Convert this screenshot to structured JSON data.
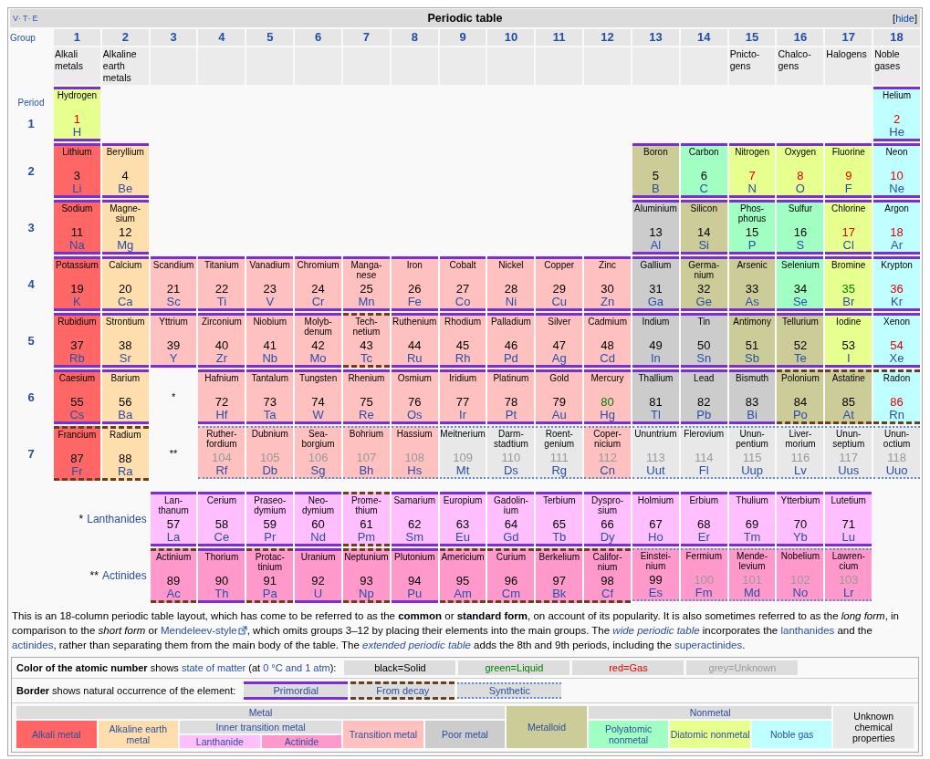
{
  "navbox": {
    "links": [
      "V",
      "T",
      "E"
    ],
    "separator": "·",
    "title": "Periodic table",
    "toggle": {
      "open": "[",
      "label": "hide",
      "close": "]"
    }
  },
  "group_heading": "Group",
  "groups": [
    {
      "number": "1",
      "name": "Alkali metals"
    },
    {
      "number": "2",
      "name": "Alkaline earth metals"
    },
    {
      "number": "3"
    },
    {
      "number": "4"
    },
    {
      "number": "5"
    },
    {
      "number": "6"
    },
    {
      "number": "7"
    },
    {
      "number": "8"
    },
    {
      "number": "9"
    },
    {
      "number": "10"
    },
    {
      "number": "11"
    },
    {
      "number": "12"
    },
    {
      "number": "13"
    },
    {
      "number": "14"
    },
    {
      "number": "15",
      "name": "Pnicto-gens"
    },
    {
      "number": "16",
      "name": "Chalco-gens"
    },
    {
      "number": "17",
      "name": "Halogens"
    },
    {
      "number": "18",
      "name": "Noble gases"
    }
  ],
  "period_heading": "Period",
  "periods": [
    {
      "label": "1",
      "cells": [
        {
          "kind": "primordial",
          "name": "Hydrogen",
          "number": {
            "text": "1",
            "color": "#e00000"
          },
          "symbol": "H",
          "color": "#e7ff8f"
        },
        {
          "kind": "empty"
        },
        {
          "kind": "empty"
        },
        {
          "kind": "empty"
        },
        {
          "kind": "empty"
        },
        {
          "kind": "empty"
        },
        {
          "kind": "empty"
        },
        {
          "kind": "empty"
        },
        {
          "kind": "empty"
        },
        {
          "kind": "empty"
        },
        {
          "kind": "empty"
        },
        {
          "kind": "empty"
        },
        {
          "kind": "empty"
        },
        {
          "kind": "empty"
        },
        {
          "kind": "empty"
        },
        {
          "kind": "empty"
        },
        {
          "kind": "empty"
        },
        {
          "kind": "primordial",
          "name": "Helium",
          "number": {
            "text": "2",
            "color": "#e00000"
          },
          "symbol": "He",
          "color": "#c0ffff"
        }
      ]
    },
    {
      "label": "2",
      "cells": [
        {
          "kind": "primordial",
          "name": "Lithium",
          "number": {
            "text": "3",
            "color": "#000000"
          },
          "symbol": "Li",
          "color": "#ff6666"
        },
        {
          "kind": "primordial",
          "name": "Beryllium",
          "number": {
            "text": "4",
            "color": "#000000"
          },
          "symbol": "Be",
          "color": "#ffdead"
        },
        {
          "kind": "empty"
        },
        {
          "kind": "empty"
        },
        {
          "kind": "empty"
        },
        {
          "kind": "empty"
        },
        {
          "kind": "empty"
        },
        {
          "kind": "empty"
        },
        {
          "kind": "empty"
        },
        {
          "kind": "empty"
        },
        {
          "kind": "empty"
        },
        {
          "kind": "empty"
        },
        {
          "kind": "primordial",
          "name": "Boron",
          "number": {
            "text": "5",
            "color": "#000000"
          },
          "symbol": "B",
          "color": "#cccc99"
        },
        {
          "kind": "primordial",
          "name": "Carbon",
          "number": {
            "text": "6",
            "color": "#000000"
          },
          "symbol": "C",
          "color": "#a1ffc3"
        },
        {
          "kind": "primordial",
          "name": "Nitrogen",
          "number": {
            "text": "7",
            "color": "#e00000"
          },
          "symbol": "N",
          "color": "#e7ff8f"
        },
        {
          "kind": "primordial",
          "name": "Oxygen",
          "number": {
            "text": "8",
            "color": "#e00000"
          },
          "symbol": "O",
          "color": "#e7ff8f"
        },
        {
          "kind": "primordial",
          "name": "Fluorine",
          "number": {
            "text": "9",
            "color": "#e00000"
          },
          "symbol": "F",
          "color": "#e7ff8f"
        },
        {
          "kind": "primordial",
          "name": "Neon",
          "number": {
            "text": "10",
            "color": "#e00000"
          },
          "symbol": "Ne",
          "color": "#c0ffff"
        }
      ]
    },
    {
      "label": "3",
      "cells": [
        {
          "kind": "primordial",
          "name": "Sodium",
          "number": {
            "text": "11",
            "color": "#000000"
          },
          "symbol": "Na",
          "color": "#ff6666"
        },
        {
          "kind": "primordial",
          "name": "Magne-sium",
          "number": {
            "text": "12",
            "color": "#000000"
          },
          "symbol": "Mg",
          "color": "#ffdead"
        },
        {
          "kind": "empty"
        },
        {
          "kind": "empty"
        },
        {
          "kind": "empty"
        },
        {
          "kind": "empty"
        },
        {
          "kind": "empty"
        },
        {
          "kind": "empty"
        },
        {
          "kind": "empty"
        },
        {
          "kind": "empty"
        },
        {
          "kind": "empty"
        },
        {
          "kind": "empty"
        },
        {
          "kind": "primordial",
          "name": "Aluminium",
          "number": {
            "text": "13",
            "color": "#000000"
          },
          "symbol": "Al",
          "color": "#cccccc"
        },
        {
          "kind": "primordial",
          "name": "Silicon",
          "number": {
            "text": "14",
            "color": "#000000"
          },
          "symbol": "Si",
          "color": "#cccc99"
        },
        {
          "kind": "primordial",
          "name": "Phos-phorus",
          "number": {
            "text": "15",
            "color": "#000000"
          },
          "symbol": "P",
          "color": "#a1ffc3"
        },
        {
          "kind": "primordial",
          "name": "Sulfur",
          "number": {
            "text": "16",
            "color": "#000000"
          },
          "symbol": "S",
          "color": "#a1ffc3"
        },
        {
          "kind": "primordial",
          "name": "Chlorine",
          "number": {
            "text": "17",
            "color": "#e00000"
          },
          "symbol": "Cl",
          "color": "#e7ff8f"
        },
        {
          "kind": "primordial",
          "name": "Argon",
          "number": {
            "text": "18",
            "color": "#e00000"
          },
          "symbol": "Ar",
          "color": "#c0ffff"
        }
      ]
    },
    {
      "label": "4",
      "cells": [
        {
          "kind": "primordial",
          "name": "Potassium",
          "number": {
            "text": "19",
            "color": "#000000"
          },
          "symbol": "K",
          "color": "#ff6666"
        },
        {
          "kind": "primordial",
          "name": "Calcium",
          "number": {
            "text": "20",
            "color": "#000000"
          },
          "symbol": "Ca",
          "color": "#ffdead"
        },
        {
          "kind": "primordial",
          "name": "Scandium",
          "number": {
            "text": "21",
            "color": "#000000"
          },
          "symbol": "Sc",
          "color": "#ffc0c0"
        },
        {
          "kind": "primordial",
          "name": "Titanium",
          "number": {
            "text": "22",
            "color": "#000000"
          },
          "symbol": "Ti",
          "color": "#ffc0c0"
        },
        {
          "kind": "primordial",
          "name": "Vanadium",
          "number": {
            "text": "23",
            "color": "#000000"
          },
          "symbol": "V",
          "color": "#ffc0c0"
        },
        {
          "kind": "primordial",
          "name": "Chromium",
          "number": {
            "text": "24",
            "color": "#000000"
          },
          "symbol": "Cr",
          "color": "#ffc0c0"
        },
        {
          "kind": "primordial",
          "name": "Manga-nese",
          "number": {
            "text": "25",
            "color": "#000000"
          },
          "symbol": "Mn",
          "color": "#ffc0c0"
        },
        {
          "kind": "primordial",
          "name": "Iron",
          "number": {
            "text": "26",
            "color": "#000000"
          },
          "symbol": "Fe",
          "color": "#ffc0c0"
        },
        {
          "kind": "primordial",
          "name": "Cobalt",
          "number": {
            "text": "27",
            "color": "#000000"
          },
          "symbol": "Co",
          "color": "#ffc0c0"
        },
        {
          "kind": "primordial",
          "name": "Nickel",
          "number": {
            "text": "28",
            "color": "#000000"
          },
          "symbol": "Ni",
          "color": "#ffc0c0"
        },
        {
          "kind": "primordial",
          "name": "Copper",
          "number": {
            "text": "29",
            "color": "#000000"
          },
          "symbol": "Cu",
          "color": "#ffc0c0"
        },
        {
          "kind": "primordial",
          "name": "Zinc",
          "number": {
            "text": "30",
            "color": "#000000"
          },
          "symbol": "Zn",
          "color": "#ffc0c0"
        },
        {
          "kind": "primordial",
          "name": "Gallium",
          "number": {
            "text": "31",
            "color": "#000000"
          },
          "symbol": "Ga",
          "color": "#cccccc"
        },
        {
          "kind": "primordial",
          "name": "Germa-nium",
          "number": {
            "text": "32",
            "color": "#000000"
          },
          "symbol": "Ge",
          "color": "#cccc99"
        },
        {
          "kind": "primordial",
          "name": "Arsenic",
          "number": {
            "text": "33",
            "color": "#000000"
          },
          "symbol": "As",
          "color": "#cccc99"
        },
        {
          "kind": "primordial",
          "name": "Selenium",
          "number": {
            "text": "34",
            "color": "#000000"
          },
          "symbol": "Se",
          "color": "#a1ffc3"
        },
        {
          "kind": "primordial",
          "name": "Bromine",
          "number": {
            "text": "35",
            "color": "#008000"
          },
          "symbol": "Br",
          "color": "#e7ff8f"
        },
        {
          "kind": "primordial",
          "name": "Krypton",
          "number": {
            "text": "36",
            "color": "#e00000"
          },
          "symbol": "Kr",
          "color": "#c0ffff"
        }
      ]
    },
    {
      "label": "5",
      "cells": [
        {
          "kind": "primordial",
          "name": "Rubidium",
          "number": {
            "text": "37",
            "color": "#000000"
          },
          "symbol": "Rb",
          "color": "#ff6666"
        },
        {
          "kind": "primordial",
          "name": "Strontium",
          "number": {
            "text": "38",
            "color": "#000000"
          },
          "symbol": "Sr",
          "color": "#ffdead"
        },
        {
          "kind": "primordial",
          "name": "Yttrium",
          "number": {
            "text": "39",
            "color": "#000000"
          },
          "symbol": "Y",
          "color": "#ffc0c0"
        },
        {
          "kind": "primordial",
          "name": "Zirconium",
          "number": {
            "text": "40",
            "color": "#000000"
          },
          "symbol": "Zr",
          "color": "#ffc0c0"
        },
        {
          "kind": "primordial",
          "name": "Niobium",
          "number": {
            "text": "41",
            "color": "#000000"
          },
          "symbol": "Nb",
          "color": "#ffc0c0"
        },
        {
          "kind": "primordial",
          "name": "Molyb-denum",
          "number": {
            "text": "42",
            "color": "#000000"
          },
          "symbol": "Mo",
          "color": "#ffc0c0"
        },
        {
          "kind": "decay",
          "name": "Tech-netium",
          "number": {
            "text": "43",
            "color": "#000000"
          },
          "symbol": "Tc",
          "color": "#ffc0c0"
        },
        {
          "kind": "primordial",
          "name": "Ruthenium",
          "number": {
            "text": "44",
            "color": "#000000"
          },
          "symbol": "Ru",
          "color": "#ffc0c0"
        },
        {
          "kind": "primordial",
          "name": "Rhodium",
          "number": {
            "text": "45",
            "color": "#000000"
          },
          "symbol": "Rh",
          "color": "#ffc0c0"
        },
        {
          "kind": "primordial",
          "name": "Palladium",
          "number": {
            "text": "46",
            "color": "#000000"
          },
          "symbol": "Pd",
          "color": "#ffc0c0"
        },
        {
          "kind": "primordial",
          "name": "Silver",
          "number": {
            "text": "47",
            "color": "#000000"
          },
          "symbol": "Ag",
          "color": "#ffc0c0"
        },
        {
          "kind": "primordial",
          "name": "Cadmium",
          "number": {
            "text": "48",
            "color": "#000000"
          },
          "symbol": "Cd",
          "color": "#ffc0c0"
        },
        {
          "kind": "primordial",
          "name": "Indium",
          "number": {
            "text": "49",
            "color": "#000000"
          },
          "symbol": "In",
          "color": "#cccccc"
        },
        {
          "kind": "primordial",
          "name": "Tin",
          "number": {
            "text": "50",
            "color": "#000000"
          },
          "symbol": "Sn",
          "color": "#cccccc"
        },
        {
          "kind": "primordial",
          "name": "Antimony",
          "number": {
            "text": "51",
            "color": "#000000"
          },
          "symbol": "Sb",
          "color": "#cccc99"
        },
        {
          "kind": "primordial",
          "name": "Tellurium",
          "number": {
            "text": "52",
            "color": "#000000"
          },
          "symbol": "Te",
          "color": "#cccc99"
        },
        {
          "kind": "primordial",
          "name": "Iodine",
          "number": {
            "text": "53",
            "color": "#000000"
          },
          "symbol": "I",
          "color": "#e7ff8f"
        },
        {
          "kind": "primordial",
          "name": "Xenon",
          "number": {
            "text": "54",
            "color": "#e00000"
          },
          "symbol": "Xe",
          "color": "#c0ffff"
        }
      ]
    },
    {
      "label": "6",
      "cells": [
        {
          "kind": "primordial",
          "name": "Caesium",
          "number": {
            "text": "55",
            "color": "#000000"
          },
          "symbol": "Cs",
          "color": "#ff6666"
        },
        {
          "kind": "primordial",
          "name": "Barium",
          "number": {
            "text": "56",
            "color": "#000000"
          },
          "symbol": "Ba",
          "color": "#ffdead"
        },
        {
          "kind": "marker",
          "text": "*"
        },
        {
          "kind": "primordial",
          "name": "Hafnium",
          "number": {
            "text": "72",
            "color": "#000000"
          },
          "symbol": "Hf",
          "color": "#ffc0c0"
        },
        {
          "kind": "primordial",
          "name": "Tantalum",
          "number": {
            "text": "73",
            "color": "#000000"
          },
          "symbol": "Ta",
          "color": "#ffc0c0"
        },
        {
          "kind": "primordial",
          "name": "Tungsten",
          "number": {
            "text": "74",
            "color": "#000000"
          },
          "symbol": "W",
          "color": "#ffc0c0"
        },
        {
          "kind": "primordial",
          "name": "Rhenium",
          "number": {
            "text": "75",
            "color": "#000000"
          },
          "symbol": "Re",
          "color": "#ffc0c0"
        },
        {
          "kind": "primordial",
          "name": "Osmium",
          "number": {
            "text": "76",
            "color": "#000000"
          },
          "symbol": "Os",
          "color": "#ffc0c0"
        },
        {
          "kind": "primordial",
          "name": "Iridium",
          "number": {
            "text": "77",
            "color": "#000000"
          },
          "symbol": "Ir",
          "color": "#ffc0c0"
        },
        {
          "kind": "primordial",
          "name": "Platinum",
          "number": {
            "text": "78",
            "color": "#000000"
          },
          "symbol": "Pt",
          "color": "#ffc0c0"
        },
        {
          "kind": "primordial",
          "name": "Gold",
          "number": {
            "text": "79",
            "color": "#000000"
          },
          "symbol": "Au",
          "color": "#ffc0c0"
        },
        {
          "kind": "primordial",
          "name": "Mercury",
          "number": {
            "text": "80",
            "color": "#008000"
          },
          "symbol": "Hg",
          "color": "#ffc0c0"
        },
        {
          "kind": "primordial",
          "name": "Thallium",
          "number": {
            "text": "81",
            "color": "#000000"
          },
          "symbol": "Tl",
          "color": "#cccccc"
        },
        {
          "kind": "primordial",
          "name": "Lead",
          "number": {
            "text": "82",
            "color": "#000000"
          },
          "symbol": "Pb",
          "color": "#cccccc"
        },
        {
          "kind": "primordial",
          "name": "Bismuth",
          "number": {
            "text": "83",
            "color": "#000000"
          },
          "symbol": "Bi",
          "color": "#cccccc"
        },
        {
          "kind": "decay",
          "name": "Polonium",
          "number": {
            "text": "84",
            "color": "#000000"
          },
          "symbol": "Po",
          "color": "#cccc99"
        },
        {
          "kind": "decay",
          "name": "Astatine",
          "number": {
            "text": "85",
            "color": "#000000"
          },
          "symbol": "At",
          "color": "#cccc99"
        },
        {
          "kind": "decay",
          "name": "Radon",
          "number": {
            "text": "86",
            "color": "#e00000"
          },
          "symbol": "Rn",
          "color": "#c0ffff"
        }
      ]
    },
    {
      "label": "7",
      "cells": [
        {
          "kind": "decay",
          "name": "Francium",
          "number": {
            "text": "87",
            "color": "#000000"
          },
          "symbol": "Fr",
          "color": "#ff6666"
        },
        {
          "kind": "decay",
          "name": "Radium",
          "number": {
            "text": "88",
            "color": "#000000"
          },
          "symbol": "Ra",
          "color": "#ffdead"
        },
        {
          "kind": "marker",
          "text": "**"
        },
        {
          "kind": "synthetic",
          "name": "Ruther-fordium",
          "number": {
            "text": "104",
            "color": "#999999"
          },
          "symbol": "Rf",
          "color": "#ffc0c0"
        },
        {
          "kind": "synthetic",
          "name": "Dubnium",
          "number": {
            "text": "105",
            "color": "#999999"
          },
          "symbol": "Db",
          "color": "#ffc0c0"
        },
        {
          "kind": "synthetic",
          "name": "Sea-borgium",
          "number": {
            "text": "106",
            "color": "#999999"
          },
          "symbol": "Sg",
          "color": "#ffc0c0"
        },
        {
          "kind": "synthetic",
          "name": "Bohrium",
          "number": {
            "text": "107",
            "color": "#999999"
          },
          "symbol": "Bh",
          "color": "#ffc0c0"
        },
        {
          "kind": "synthetic",
          "name": "Hassium",
          "number": {
            "text": "108",
            "color": "#999999"
          },
          "symbol": "Hs",
          "color": "#ffc0c0"
        },
        {
          "kind": "synthetic",
          "name": "Meitnerium",
          "number": {
            "text": "109",
            "color": "#999999"
          },
          "symbol": "Mt",
          "color": "#e8e8e8"
        },
        {
          "kind": "synthetic",
          "name": "Darm-stadtium",
          "number": {
            "text": "110",
            "color": "#999999"
          },
          "symbol": "Ds",
          "color": "#e8e8e8"
        },
        {
          "kind": "synthetic",
          "name": "Roent-genium",
          "number": {
            "text": "111",
            "color": "#999999"
          },
          "symbol": "Rg",
          "color": "#e8e8e8"
        },
        {
          "kind": "synthetic",
          "name": "Coper-nicium",
          "number": {
            "text": "112",
            "color": "#999999"
          },
          "symbol": "Cn",
          "color": "#ffc0c0"
        },
        {
          "kind": "synthetic",
          "name": "Ununtrium",
          "number": {
            "text": "113",
            "color": "#999999"
          },
          "symbol": "Uut",
          "color": "#e8e8e8"
        },
        {
          "kind": "synthetic",
          "name": "Flerovium",
          "number": {
            "text": "114",
            "color": "#999999"
          },
          "symbol": "Fl",
          "color": "#e8e8e8"
        },
        {
          "kind": "synthetic",
          "name": "Unun-pentium",
          "number": {
            "text": "115",
            "color": "#999999"
          },
          "symbol": "Uup",
          "color": "#e8e8e8"
        },
        {
          "kind": "synthetic",
          "name": "Liver-morium",
          "number": {
            "text": "116",
            "color": "#999999"
          },
          "symbol": "Lv",
          "color": "#e8e8e8"
        },
        {
          "kind": "synthetic",
          "name": "Unun-septium",
          "number": {
            "text": "117",
            "color": "#999999"
          },
          "symbol": "Uus",
          "color": "#e8e8e8"
        },
        {
          "kind": "synthetic",
          "name": "Unun-octium",
          "number": {
            "text": "118",
            "color": "#999999"
          },
          "symbol": "Uuo",
          "color": "#e8e8e8"
        }
      ]
    }
  ],
  "series": [
    {
      "mark": "*",
      "label": "Lanthanides",
      "cells": [
        {
          "kind": "primordial",
          "name": "Lan-thanum",
          "number": {
            "text": "57",
            "color": "#000000"
          },
          "symbol": "La",
          "color": "#ffbfff"
        },
        {
          "kind": "primordial",
          "name": "Cerium",
          "number": {
            "text": "58",
            "color": "#000000"
          },
          "symbol": "Ce",
          "color": "#ffbfff"
        },
        {
          "kind": "primordial",
          "name": "Praseo-dymium",
          "number": {
            "text": "59",
            "color": "#000000"
          },
          "symbol": "Pr",
          "color": "#ffbfff"
        },
        {
          "kind": "primordial",
          "name": "Neo-dymium",
          "number": {
            "text": "60",
            "color": "#000000"
          },
          "symbol": "Nd",
          "color": "#ffbfff"
        },
        {
          "kind": "decay",
          "name": "Prome-thium",
          "number": {
            "text": "61",
            "color": "#000000"
          },
          "symbol": "Pm",
          "color": "#ffbfff"
        },
        {
          "kind": "primordial",
          "name": "Samarium",
          "number": {
            "text": "62",
            "color": "#000000"
          },
          "symbol": "Sm",
          "color": "#ffbfff"
        },
        {
          "kind": "primordial",
          "name": "Europium",
          "number": {
            "text": "63",
            "color": "#000000"
          },
          "symbol": "Eu",
          "color": "#ffbfff"
        },
        {
          "kind": "primordial",
          "name": "Gadolin-ium",
          "number": {
            "text": "64",
            "color": "#000000"
          },
          "symbol": "Gd",
          "color": "#ffbfff"
        },
        {
          "kind": "primordial",
          "name": "Terbium",
          "number": {
            "text": "65",
            "color": "#000000"
          },
          "symbol": "Tb",
          "color": "#ffbfff"
        },
        {
          "kind": "primordial",
          "name": "Dyspro-sium",
          "number": {
            "text": "66",
            "color": "#000000"
          },
          "symbol": "Dy",
          "color": "#ffbfff"
        },
        {
          "kind": "primordial",
          "name": "Holmium",
          "number": {
            "text": "67",
            "color": "#000000"
          },
          "symbol": "Ho",
          "color": "#ffbfff"
        },
        {
          "kind": "primordial",
          "name": "Erbium",
          "number": {
            "text": "68",
            "color": "#000000"
          },
          "symbol": "Er",
          "color": "#ffbfff"
        },
        {
          "kind": "primordial",
          "name": "Thulium",
          "number": {
            "text": "69",
            "color": "#000000"
          },
          "symbol": "Tm",
          "color": "#ffbfff"
        },
        {
          "kind": "primordial",
          "name": "Ytterbium",
          "number": {
            "text": "70",
            "color": "#000000"
          },
          "symbol": "Yb",
          "color": "#ffbfff"
        },
        {
          "kind": "primordial",
          "name": "Lutetium",
          "number": {
            "text": "71",
            "color": "#000000"
          },
          "symbol": "Lu",
          "color": "#ffbfff"
        }
      ]
    },
    {
      "mark": "**",
      "label": "Actinides",
      "cells": [
        {
          "kind": "decay",
          "name": "Actinium",
          "number": {
            "text": "89",
            "color": "#000000"
          },
          "symbol": "Ac",
          "color": "#ff99cc"
        },
        {
          "kind": "primordial",
          "name": "Thorium",
          "number": {
            "text": "90",
            "color": "#000000"
          },
          "symbol": "Th",
          "color": "#ff99cc"
        },
        {
          "kind": "decay",
          "name": "Protac-tinium",
          "number": {
            "text": "91",
            "color": "#000000"
          },
          "symbol": "Pa",
          "color": "#ff99cc"
        },
        {
          "kind": "primordial",
          "name": "Uranium",
          "number": {
            "text": "92",
            "color": "#000000"
          },
          "symbol": "U",
          "color": "#ff99cc"
        },
        {
          "kind": "decay",
          "name": "Neptunium",
          "number": {
            "text": "93",
            "color": "#000000"
          },
          "symbol": "Np",
          "color": "#ff99cc"
        },
        {
          "kind": "primordial",
          "name": "Plutonium",
          "number": {
            "text": "94",
            "color": "#000000"
          },
          "symbol": "Pu",
          "color": "#ff99cc"
        },
        {
          "kind": "decay",
          "name": "Americium",
          "number": {
            "text": "95",
            "color": "#000000"
          },
          "symbol": "Am",
          "color": "#ff99cc"
        },
        {
          "kind": "decay",
          "name": "Curium",
          "number": {
            "text": "96",
            "color": "#000000"
          },
          "symbol": "Cm",
          "color": "#ff99cc"
        },
        {
          "kind": "decay",
          "name": "Berkelium",
          "number": {
            "text": "97",
            "color": "#000000"
          },
          "symbol": "Bk",
          "color": "#ff99cc"
        },
        {
          "kind": "decay",
          "name": "Califor-nium",
          "number": {
            "text": "98",
            "color": "#000000"
          },
          "symbol": "Cf",
          "color": "#ff99cc"
        },
        {
          "kind": "synthetic",
          "name": "Einstei-nium",
          "number": {
            "text": "99",
            "color": "#000000"
          },
          "symbol": "Es",
          "color": "#ff99cc"
        },
        {
          "kind": "synthetic",
          "name": "Fermium",
          "number": {
            "text": "100",
            "color": "#999999"
          },
          "symbol": "Fm",
          "color": "#ff99cc"
        },
        {
          "kind": "synthetic",
          "name": "Mende-levium",
          "number": {
            "text": "101",
            "color": "#999999"
          },
          "symbol": "Md",
          "color": "#ff99cc"
        },
        {
          "kind": "synthetic",
          "name": "Nobelium",
          "number": {
            "text": "102",
            "color": "#999999"
          },
          "symbol": "No",
          "color": "#ff99cc"
        },
        {
          "kind": "synthetic",
          "name": "Lawren-cium",
          "number": {
            "text": "103",
            "color": "#999999"
          },
          "symbol": "Lr",
          "color": "#ff99cc"
        }
      ]
    }
  ],
  "description": [
    {
      "kind": "text",
      "text": "This is an 18-column periodic table layout, which has come to be referred to as the **common** or **standard form**, on account of its popularity. It is also sometimes referred to as the *long form*, in comparison to the *short form* or "
    },
    {
      "kind": "external_link",
      "text": "Mendeleev-style"
    },
    {
      "kind": "text",
      "text": ", which omits groups 3–12 by placing their elements into the main groups. The "
    },
    {
      "kind": "italic_link",
      "text": "wide periodic table"
    },
    {
      "kind": "text",
      "text": " incorporates the "
    },
    {
      "kind": "link",
      "text": "lanthanides"
    },
    {
      "kind": "text",
      "text": " and the "
    },
    {
      "kind": "link",
      "text": "actinides"
    },
    {
      "kind": "text",
      "text": ", rather than separating them from the main body of the table. The "
    },
    {
      "kind": "italic_link",
      "text": "extended periodic table"
    },
    {
      "kind": "text",
      "text": " adds the 8th and 9th periods, including the "
    },
    {
      "kind": "link",
      "text": "superactinides"
    },
    {
      "kind": "text",
      "text": "."
    }
  ],
  "legend": {
    "state": {
      "caption": [
        {
          "kind": "text",
          "text": "**Color of the atomic number** shows "
        },
        {
          "kind": "link",
          "text": "state of matter"
        },
        {
          "kind": "text",
          "text": " (at "
        },
        {
          "kind": "link",
          "text": "0 °C and 1 atm"
        },
        {
          "kind": "text",
          "text": "):"
        }
      ],
      "items": [
        {
          "text": "black=Solid",
          "color": "#000000"
        },
        {
          "text": "green=Liquid",
          "color": "#008000"
        },
        {
          "text": "red=Gas",
          "color": "#e00000"
        },
        {
          "text": "grey=Unknown",
          "color": "#999999"
        }
      ]
    },
    "occurrence": {
      "caption": [
        {
          "kind": "text",
          "text": "**Border** shows natural occurrence of the element:"
        }
      ],
      "items": [
        {
          "kind": "primordial",
          "text": "Primordial"
        },
        {
          "kind": "decay",
          "text": "From decay"
        },
        {
          "kind": "synthetic",
          "text": "Synthetic"
        }
      ]
    },
    "categories": [
      {
        "kind": "group",
        "label": "Metal",
        "items": [
          {
            "kind": "single",
            "label": "Alkali metal",
            "color": "#ff6666"
          },
          {
            "kind": "single",
            "label": "Alkaline earth metal",
            "color": "#ffdead"
          },
          {
            "kind": "group",
            "label": "Inner transition metal",
            "items": [
              {
                "kind": "single",
                "label": "Lanthanide",
                "color": "#ffbfff"
              },
              {
                "kind": "single",
                "label": "Actinide",
                "color": "#ff99cc"
              }
            ]
          },
          {
            "kind": "single",
            "label": "Transition metal",
            "color": "#ffc0c0"
          },
          {
            "kind": "single",
            "label": "Poor metal",
            "color": "#cccccc"
          }
        ]
      },
      {
        "kind": "single",
        "label": "Metalloid",
        "color": "#cccc99"
      },
      {
        "kind": "group",
        "label": "Nonmetal",
        "items": [
          {
            "kind": "single",
            "label": "Polyatomic nonmetal",
            "color": "#a1ffc3"
          },
          {
            "kind": "single",
            "label": "Diatomic nonmetal",
            "color": "#e7ff8f"
          },
          {
            "kind": "single",
            "label": "Noble gas",
            "color": "#c0ffff"
          }
        ]
      },
      {
        "kind": "plain",
        "label": "Unknown chemical properties",
        "color": "#e8e8e8"
      }
    ]
  }
}
